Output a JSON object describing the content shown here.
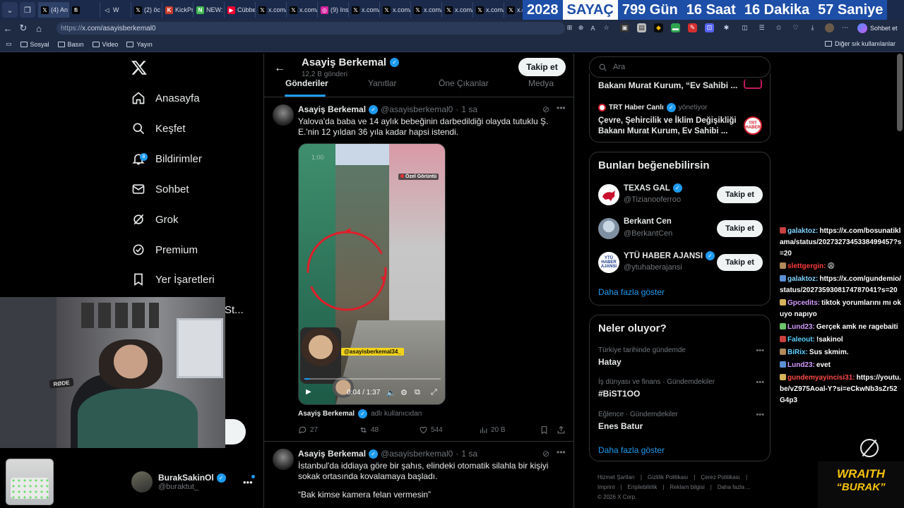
{
  "browser": {
    "tabs": [
      {
        "fav": "𝕏",
        "label": "(4) An",
        "favbg": "#000",
        "favfg": "#fff"
      },
      {
        "fav": "fi",
        "label": "",
        "favbg": "#000",
        "favfg": "#fff"
      },
      {
        "fav": "◁",
        "label": "W",
        "favbg": "#1b2a4a",
        "favfg": "#fff"
      },
      {
        "fav": "𝕏",
        "label": "(2) öc",
        "favbg": "#000",
        "favfg": "#fff"
      },
      {
        "fav": "K",
        "label": "KickPr",
        "favbg": "#c83b2a",
        "favfg": "#fff"
      },
      {
        "fav": "N",
        "label": "NEW:",
        "favbg": "#3fb950",
        "favfg": "#fff"
      },
      {
        "fav": "▶",
        "label": "Cübbe",
        "favbg": "#ff0033",
        "favfg": "#fff"
      },
      {
        "fav": "𝕏",
        "label": "x.com/",
        "favbg": "#000",
        "favfg": "#fff"
      },
      {
        "fav": "𝕏",
        "label": "x.com/",
        "favbg": "#000",
        "favfg": "#fff"
      },
      {
        "fav": "◎",
        "label": "(9) Ins",
        "favbg": "#d6249f",
        "favfg": "#fff"
      },
      {
        "fav": "𝕏",
        "label": "x.com/",
        "favbg": "#000",
        "favfg": "#fff"
      },
      {
        "fav": "𝕏",
        "label": "x.com/",
        "favbg": "#000",
        "favfg": "#fff"
      },
      {
        "fav": "𝕏",
        "label": "x.com/",
        "favbg": "#000",
        "favfg": "#fff"
      },
      {
        "fav": "𝕏",
        "label": "x.com/",
        "favbg": "#000",
        "favfg": "#fff"
      },
      {
        "fav": "𝕏",
        "label": "x.com/",
        "favbg": "#000",
        "favfg": "#fff"
      },
      {
        "fav": "𝕏",
        "label": "x.com/",
        "favbg": "#000",
        "favfg": "#fff"
      }
    ],
    "counter": {
      "year": "2028",
      "label": "SAYAÇ",
      "days": "799 Gün",
      "hours": "16 Saat",
      "minutes": "16 Dakika",
      "seconds": "57 Saniye"
    },
    "url_prefix": "https://",
    "url_host": "x.com/asayisberkemal0",
    "chat_label": "Sohbet et",
    "bookmarks": [
      "Sosyal",
      "Basın",
      "Video",
      "Yayın"
    ],
    "other_bookmarks": "Diğer sık kullanılanlar"
  },
  "nav": {
    "items": [
      {
        "label": "Anasayfa",
        "icon": "home-icon"
      },
      {
        "label": "Keşfet",
        "icon": "search-icon"
      },
      {
        "label": "Bildirimler",
        "icon": "bell-icon",
        "badge": "8"
      },
      {
        "label": "Sohbet",
        "icon": "mail-icon"
      },
      {
        "label": "Grok",
        "icon": "grok-icon"
      },
      {
        "label": "Premium",
        "icon": "premium-icon"
      },
      {
        "label": "Yer İşaretleri",
        "icon": "bookmark-icon"
      }
    ],
    "hidden_item_fragment": "St...",
    "profile": {
      "name": "BurakSakinOl",
      "handle": "@buraktut_"
    }
  },
  "header": {
    "title": "Asayiş Berkemal",
    "post_count": "12,2 B gönderi",
    "follow": "Takip et",
    "tabs": [
      "Gönderiler",
      "Yanıtlar",
      "Öne Çıkanlar",
      "Medya"
    ]
  },
  "posts": [
    {
      "name": "Asayiş Berkemal",
      "handle": "@asayisberkemal0",
      "time": "1 sa",
      "text": "Yalova'da baba ve 14 aylık bebeğinin darbedildiği olayda tutuklu Ş. E.'nin 12 yıldan 36 yıla kadar hapsi istendi.",
      "video": {
        "tag": "Özel Görüntü",
        "ghost_time": "1:00",
        "handle_tag": "@asayisberkemal34_",
        "clock": "0:04 / 1:37",
        "progress": 0.04
      },
      "attrib_name": "Asayiş Berkemal",
      "attrib_suffix": "adlı kullanıcıdan",
      "stats": {
        "replies": "27",
        "reposts": "48",
        "likes": "544",
        "views": "20 B"
      }
    },
    {
      "name": "Asayiş Berkemal",
      "handle": "@asayisberkemal0",
      "time": "1 sa",
      "text": "İstanbul'da iddiaya göre bir şahıs, elindeki otomatik silahla bir kişiyi sokak ortasında kovalamaya başladı.",
      "quote": "“Bak kimse kamera felan vermesin”"
    }
  ],
  "right": {
    "search_placeholder": "Ara",
    "news1_fragment": "Bakanı Murat Kurum, “Ev Sahibi ...",
    "news2_source": "TRT Haber Canlı",
    "news2_meta": "yönetiyor",
    "news2_title": "Çevre, Şehircilik ve İklim Değişikliği Bakanı Murat Kurum, Ev Sahibi ...",
    "trt_logo": "TRT HABER",
    "suggest_title": "Bunları beğenebilirsin",
    "suggestions": [
      {
        "name": "TEXAS GAL",
        "handle": "@Tizianooferroo",
        "button": "Takip et"
      },
      {
        "name": "Berkant Cen",
        "handle": "@BerkantCen",
        "button": "Takip et"
      },
      {
        "name": "YTÜ HABER AJANSI",
        "handle": "@ytuhaberajansi",
        "button": "Takip et"
      }
    ],
    "ytu_logo": "YTÜ HABER AJANSI",
    "show_more": "Daha fazla göster",
    "trends_title": "Neler oluyor?",
    "trends": [
      {
        "context": "Türkiye tarihinde gündemde",
        "title": "Hatay"
      },
      {
        "context": "İş dünyası ve finans · Gündemdekiler",
        "title": "#BiST1OO"
      },
      {
        "context": "Eğlence · Gündemdekiler",
        "title": "Enes Batur"
      }
    ],
    "show_more2": "Daha fazla göster",
    "footer": [
      "Hizmet Şartları",
      "|",
      "Gizlilik Politikası",
      "|",
      "Çerez Politikası",
      "|",
      "Imprint",
      "|",
      "Erişilebilirlik",
      "|",
      "Reklam bilgisi",
      "|",
      "Daha fazla ...",
      "© 2026 X Corp."
    ]
  },
  "stream": {
    "mic_brand": "RØDE",
    "chat": [
      {
        "user": "galaktoz:",
        "msg": "https://x.com/bosunatiklama/status/2027327345338499457?s=20",
        "color": "#7fd4ff"
      },
      {
        "user": "slettgergin:",
        "msg": "😩",
        "color": "#ff3b3b"
      },
      {
        "user": "galaktoz:",
        "msg": "https://x.com/gundemio/status/2027359308174787041?s=20",
        "color": "#7fd4ff"
      },
      {
        "user": "Gpcedits:",
        "msg": "tiktok yorumlarını mı okuyo napıyo",
        "color": "#d49bff"
      },
      {
        "user": "Lund23:",
        "msg": "Gerçek amk ne ragebaiti",
        "color": "#d49bff"
      },
      {
        "user": "Faleout:",
        "msg": "!sakinol",
        "color": "#5ad1ff"
      },
      {
        "user": "BiRix:",
        "msg": "Sus skmim.",
        "color": "#5ad1ff"
      },
      {
        "user": "Lund23:",
        "msg": "evet",
        "color": "#d49bff"
      },
      {
        "user": "gundemyayincisi31:",
        "msg": "https://youtu.be/vZ975Aoal-Y?si=eCkwNb3sZr52G4p3",
        "color": "#ff4a4a"
      }
    ],
    "wraith_line1": "WRAITH",
    "wraith_line2": "“BURAK”"
  }
}
